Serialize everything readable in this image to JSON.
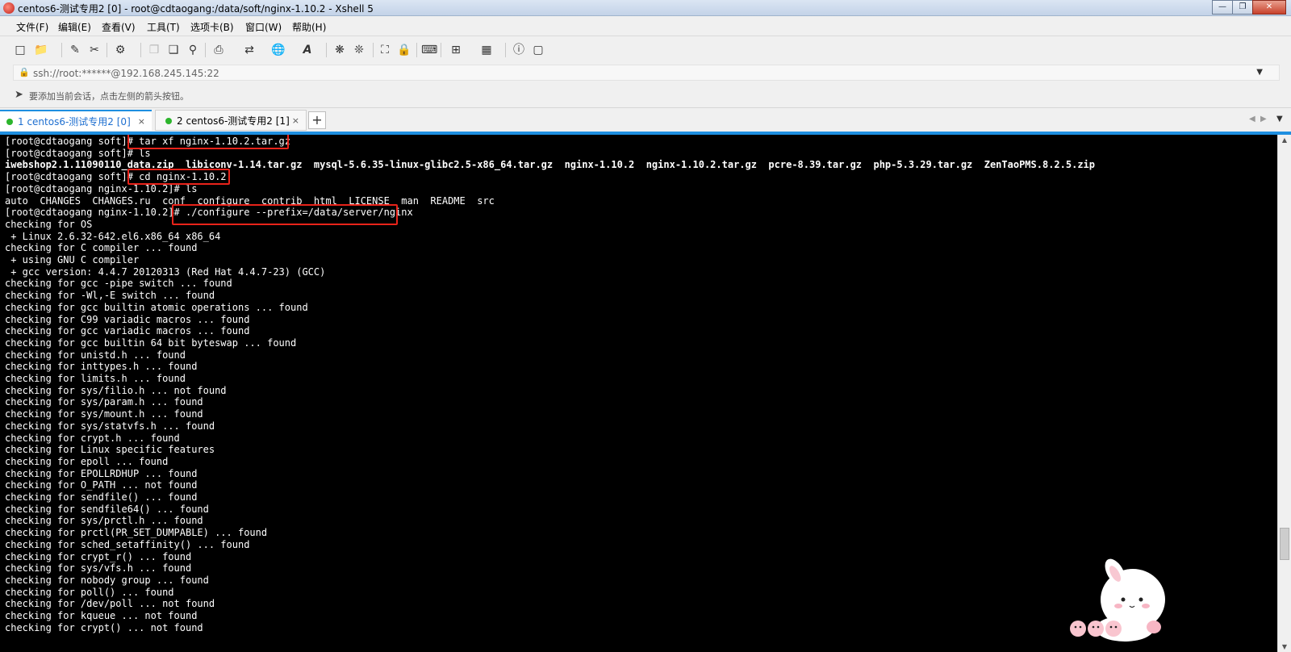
{
  "window": {
    "title": "centos6-测试专用2 [0] - root@cdtaogang:/data/soft/nginx-1.10.2 - Xshell 5",
    "controls": [
      "minimize",
      "restore",
      "close"
    ]
  },
  "menu": {
    "items": [
      "文件(F)",
      "编辑(E)",
      "查看(V)",
      "工具(T)",
      "选项卡(B)",
      "窗口(W)",
      "帮助(H)"
    ]
  },
  "toolbar": {
    "icons": [
      "new-session-icon",
      "open-folder-icon",
      "connect-icon",
      "disconnect-icon",
      "properties-icon",
      "copy-icon",
      "paste-icon",
      "find-icon",
      "print-icon",
      "transfer-icon",
      "globe-icon",
      "font-icon",
      "xftp-icon",
      "xmanager-icon",
      "fullscreen-icon",
      "lock-icon",
      "keyboard-icon",
      "compose-icon",
      "layout-icon",
      "help-icon",
      "chat-icon"
    ]
  },
  "address": {
    "value": "ssh://root:******@192.168.245.145:22"
  },
  "session_hint": {
    "text": "要添加当前会话，点击左侧的箭头按钮。"
  },
  "tabs": [
    {
      "label": "1 centos6-测试专用2 [0]",
      "close": "×",
      "active": true
    },
    {
      "label": "2 centos6-测试专用2 [1]",
      "close": "×",
      "active": false
    }
  ],
  "tab_add": "+",
  "terminal": {
    "lines": [
      {
        "text": "[root@cdtaogang soft]# tar xf nginx-1.10.2.tar.gz",
        "bold": false
      },
      {
        "text": "[root@cdtaogang soft]# ls",
        "bold": false
      },
      {
        "text": "iwebshop2.1.11090110_data.zip  libiconv-1.14.tar.gz  mysql-5.6.35-linux-glibc2.5-x86_64.tar.gz  nginx-1.10.2  nginx-1.10.2.tar.gz  pcre-8.39.tar.gz  php-5.3.29.tar.gz  ZenTaoPMS.8.2.5.zip",
        "bold": true
      },
      {
        "text": "[root@cdtaogang soft]# cd nginx-1.10.2",
        "bold": false
      },
      {
        "text": "[root@cdtaogang nginx-1.10.2]# ls",
        "bold": false
      },
      {
        "text": "auto  CHANGES  CHANGES.ru  conf  configure  contrib  html  LICENSE  man  README  src",
        "bold": false
      },
      {
        "text": "[root@cdtaogang nginx-1.10.2]# ./configure --prefix=/data/server/nginx",
        "bold": false
      },
      {
        "text": "checking for OS",
        "bold": false
      },
      {
        "text": " + Linux 2.6.32-642.el6.x86_64 x86_64",
        "bold": false
      },
      {
        "text": "checking for C compiler ... found",
        "bold": false
      },
      {
        "text": " + using GNU C compiler",
        "bold": false
      },
      {
        "text": " + gcc version: 4.4.7 20120313 (Red Hat 4.4.7-23) (GCC)",
        "bold": false
      },
      {
        "text": "checking for gcc -pipe switch ... found",
        "bold": false
      },
      {
        "text": "checking for -Wl,-E switch ... found",
        "bold": false
      },
      {
        "text": "checking for gcc builtin atomic operations ... found",
        "bold": false
      },
      {
        "text": "checking for C99 variadic macros ... found",
        "bold": false
      },
      {
        "text": "checking for gcc variadic macros ... found",
        "bold": false
      },
      {
        "text": "checking for gcc builtin 64 bit byteswap ... found",
        "bold": false
      },
      {
        "text": "checking for unistd.h ... found",
        "bold": false
      },
      {
        "text": "checking for inttypes.h ... found",
        "bold": false
      },
      {
        "text": "checking for limits.h ... found",
        "bold": false
      },
      {
        "text": "checking for sys/filio.h ... not found",
        "bold": false
      },
      {
        "text": "checking for sys/param.h ... found",
        "bold": false
      },
      {
        "text": "checking for sys/mount.h ... found",
        "bold": false
      },
      {
        "text": "checking for sys/statvfs.h ... found",
        "bold": false
      },
      {
        "text": "checking for crypt.h ... found",
        "bold": false
      },
      {
        "text": "checking for Linux specific features",
        "bold": false
      },
      {
        "text": "checking for epoll ... found",
        "bold": false
      },
      {
        "text": "checking for EPOLLRDHUP ... found",
        "bold": false
      },
      {
        "text": "checking for O_PATH ... not found",
        "bold": false
      },
      {
        "text": "checking for sendfile() ... found",
        "bold": false
      },
      {
        "text": "checking for sendfile64() ... found",
        "bold": false
      },
      {
        "text": "checking for sys/prctl.h ... found",
        "bold": false
      },
      {
        "text": "checking for prctl(PR_SET_DUMPABLE) ... found",
        "bold": false
      },
      {
        "text": "checking for sched_setaffinity() ... found",
        "bold": false
      },
      {
        "text": "checking for crypt_r() ... found",
        "bold": false
      },
      {
        "text": "checking for sys/vfs.h ... found",
        "bold": false
      },
      {
        "text": "checking for nobody group ... found",
        "bold": false
      },
      {
        "text": "checking for poll() ... found",
        "bold": false
      },
      {
        "text": "checking for /dev/poll ... not found",
        "bold": false
      },
      {
        "text": "checking for kqueue ... not found",
        "bold": false
      },
      {
        "text": "checking for crypt() ... not found",
        "bold": false
      }
    ]
  },
  "highlight_color": "#e8231a",
  "accent_color": "#1e8fe0"
}
